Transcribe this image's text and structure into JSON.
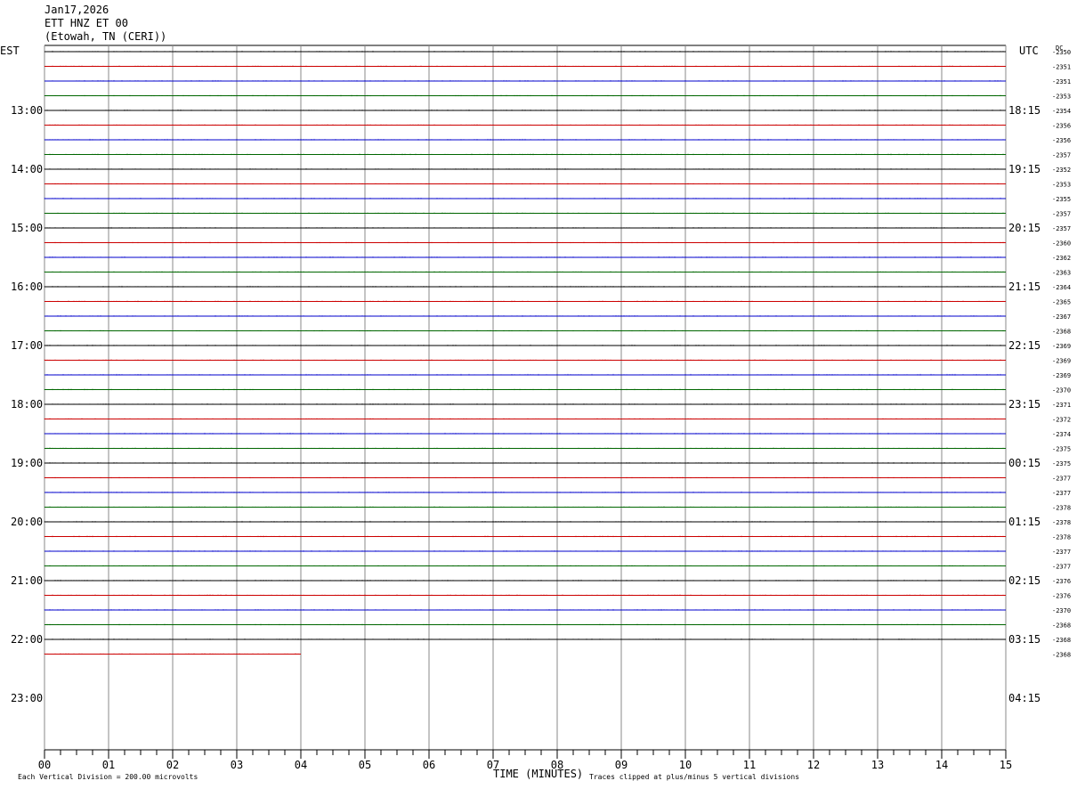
{
  "header": {
    "date": "Jan17,2026",
    "station": "ETT HNZ ET 00",
    "location": "(Etowah, TN (CERI))"
  },
  "chart_data": {
    "type": "line",
    "title": "ETT HNZ ET 00",
    "xlabel": "TIME (MINUTES)",
    "xlim": [
      0,
      15
    ],
    "x_ticks": [
      "00",
      "01",
      "02",
      "03",
      "04",
      "05",
      "06",
      "07",
      "08",
      "09",
      "10",
      "11",
      "12",
      "13",
      "14",
      "15"
    ],
    "left_axis_label": "EST",
    "right_axis_label": "UTC",
    "dc_label": "DC",
    "left_hour_labels": [
      "13:00",
      "14:00",
      "15:00",
      "16:00",
      "17:00",
      "18:00",
      "19:00",
      "20:00",
      "21:00",
      "22:00",
      "23:00"
    ],
    "right_hour_labels": [
      "18:15",
      "19:15",
      "20:15",
      "21:15",
      "22:15",
      "23:15",
      "00:15",
      "01:15",
      "02:15",
      "03:15",
      "04:15"
    ],
    "dc_offsets": [
      "-2350",
      "-2351",
      "-2351",
      "-2353",
      "-2354",
      "-2356",
      "-2356",
      "-2357",
      "-2352",
      "-2353",
      "-2355",
      "-2357",
      "-2357",
      "-2360",
      "-2362",
      "-2363",
      "-2364",
      "-2365",
      "-2367",
      "-2368",
      "-2369",
      "-2369",
      "-2369",
      "-2370",
      "-2371",
      "-2372",
      "-2374",
      "-2375",
      "-2375",
      "-2377",
      "-2377",
      "-2378",
      "-2378",
      "-2378",
      "-2377",
      "-2377",
      "-2376",
      "-2376",
      "-2370",
      "-2368",
      "-2368",
      "-2368"
    ],
    "trace_colors": [
      "#000000",
      "#cc0000",
      "#0000cc",
      "#006600"
    ],
    "final_trace_end_minute": 4,
    "footer_left": "Each Vertical Division =  200.00 microvolts",
    "footer_right": "Traces clipped at plus/minus 5 vertical divisions"
  }
}
